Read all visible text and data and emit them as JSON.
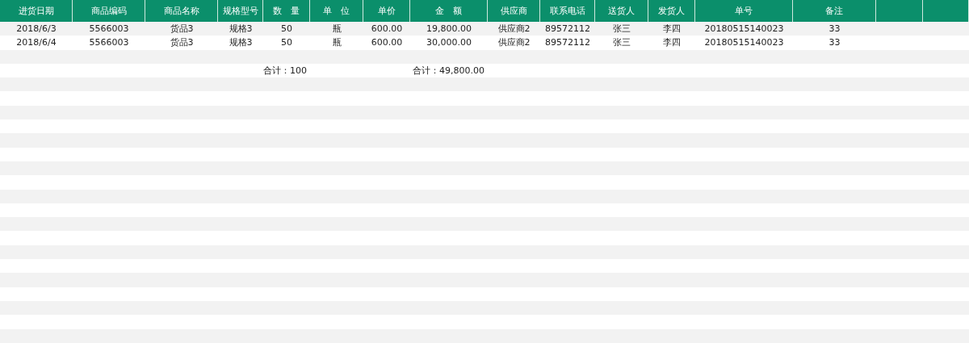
{
  "table": {
    "columns": [
      "进货日期",
      "商品编码",
      "商品名称",
      "规格型号",
      "数　量",
      "单　位",
      "单价",
      "金　额",
      "供应商",
      "联系电话",
      "送货人",
      "发货人",
      "单号",
      "备注",
      "",
      ""
    ],
    "rows": [
      [
        "2018/6/3",
        "5566003",
        "货品3",
        "规格3",
        "50",
        "瓶",
        "600.00",
        "19,800.00",
        "供应商2",
        "89572112",
        "张三",
        "李四",
        "20180515140023",
        "33"
      ],
      [
        "2018/6/4",
        "5566003",
        "货品3",
        "规格3",
        "50",
        "瓶",
        "600.00",
        "30,000.00",
        "供应商2",
        "89572112",
        "张三",
        "李四",
        "20180515140023",
        "33"
      ]
    ],
    "totals": {
      "quantity": "合计：100",
      "amount": "合计：49,800.00"
    }
  }
}
